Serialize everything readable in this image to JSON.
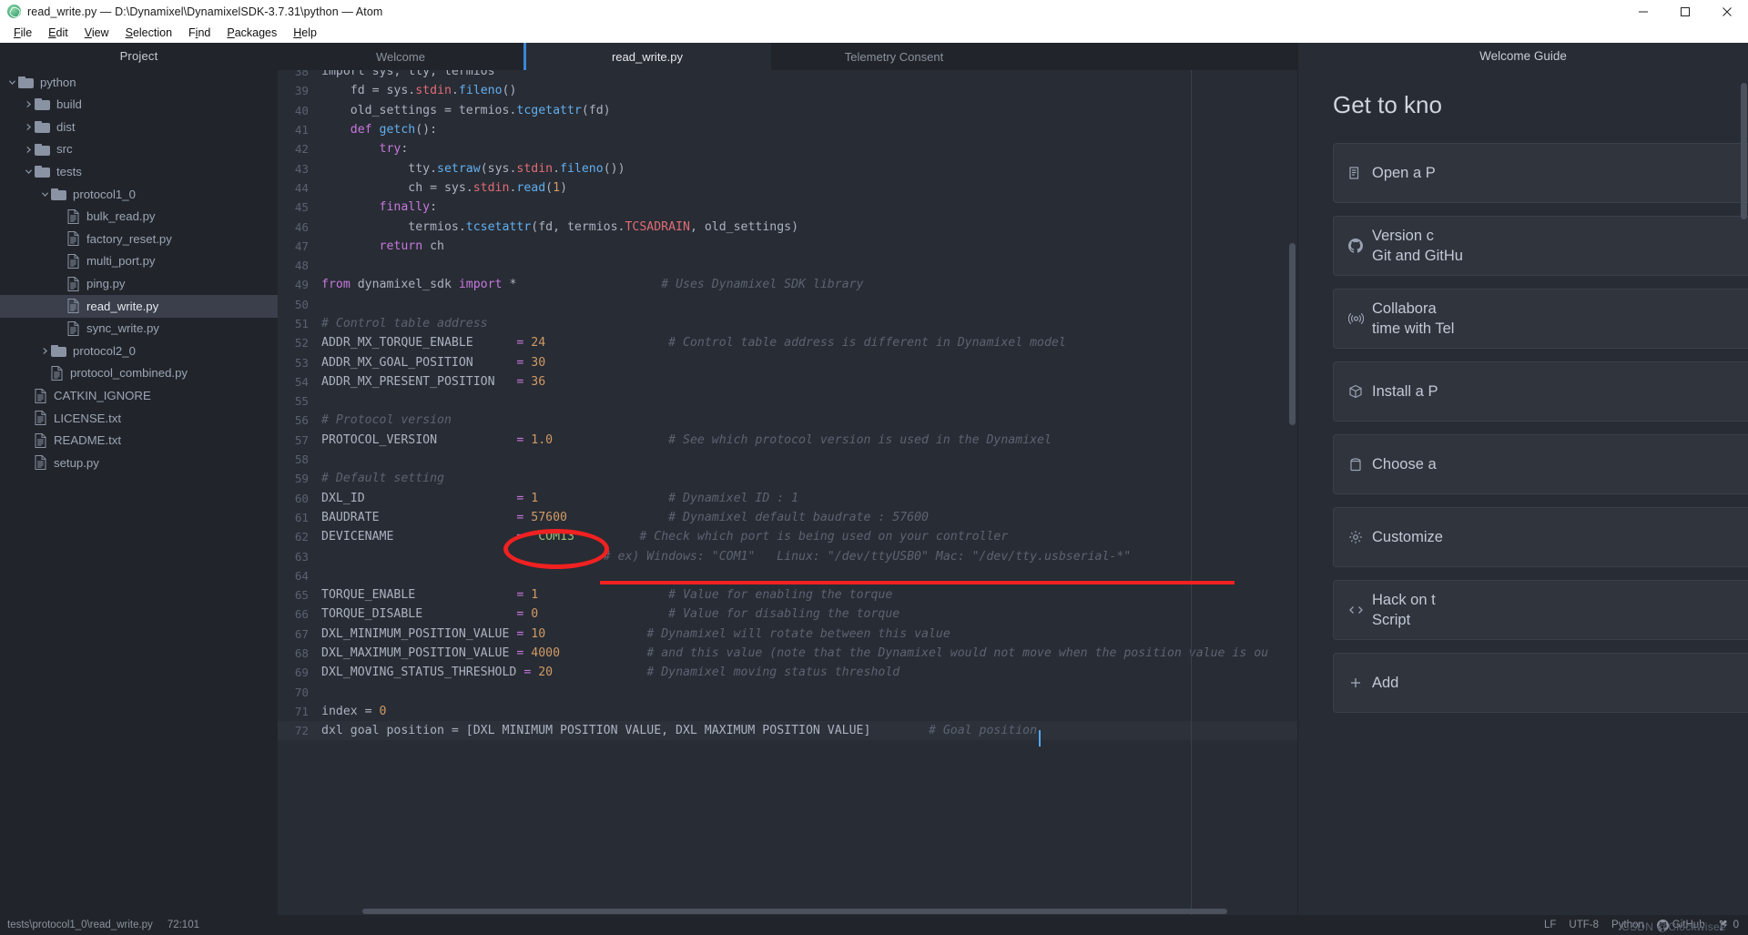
{
  "window": {
    "title": "read_write.py — D:\\Dynamixel\\DynamixelSDK-3.7.31\\python — Atom",
    "app_icon": "atom-icon",
    "controls": {
      "minimize": "minimize-icon",
      "maximize": "maximize-icon",
      "close": "close-icon"
    }
  },
  "menu": {
    "items": [
      "File",
      "Edit",
      "View",
      "Selection",
      "Find",
      "Packages",
      "Help"
    ]
  },
  "sidebar": {
    "title": "Project",
    "tree": [
      {
        "label": "python",
        "type": "folder",
        "depth": 0,
        "twisty": "chevron-down",
        "selected": false
      },
      {
        "label": "build",
        "type": "folder",
        "depth": 1,
        "twisty": "chevron-right",
        "selected": false
      },
      {
        "label": "dist",
        "type": "folder",
        "depth": 1,
        "twisty": "chevron-right",
        "selected": false
      },
      {
        "label": "src",
        "type": "folder",
        "depth": 1,
        "twisty": "chevron-right",
        "selected": false
      },
      {
        "label": "tests",
        "type": "folder",
        "depth": 1,
        "twisty": "chevron-down",
        "selected": false
      },
      {
        "label": "protocol1_0",
        "type": "folder",
        "depth": 2,
        "twisty": "chevron-down",
        "selected": false
      },
      {
        "label": "bulk_read.py",
        "type": "file",
        "depth": 3,
        "twisty": "",
        "selected": false
      },
      {
        "label": "factory_reset.py",
        "type": "file",
        "depth": 3,
        "twisty": "",
        "selected": false
      },
      {
        "label": "multi_port.py",
        "type": "file",
        "depth": 3,
        "twisty": "",
        "selected": false
      },
      {
        "label": "ping.py",
        "type": "file",
        "depth": 3,
        "twisty": "",
        "selected": false
      },
      {
        "label": "read_write.py",
        "type": "file",
        "depth": 3,
        "twisty": "",
        "selected": true
      },
      {
        "label": "sync_write.py",
        "type": "file",
        "depth": 3,
        "twisty": "",
        "selected": false
      },
      {
        "label": "protocol2_0",
        "type": "folder",
        "depth": 2,
        "twisty": "chevron-right",
        "selected": false
      },
      {
        "label": "protocol_combined.py",
        "type": "file",
        "depth": 2,
        "twisty": "",
        "selected": false
      },
      {
        "label": "CATKIN_IGNORE",
        "type": "file",
        "depth": 1,
        "twisty": "",
        "selected": false
      },
      {
        "label": "LICENSE.txt",
        "type": "file",
        "depth": 1,
        "twisty": "",
        "selected": false
      },
      {
        "label": "README.txt",
        "type": "file",
        "depth": 1,
        "twisty": "",
        "selected": false
      },
      {
        "label": "setup.py",
        "type": "file",
        "depth": 1,
        "twisty": "",
        "selected": false
      }
    ]
  },
  "tabs": [
    {
      "label": "Welcome",
      "active": false
    },
    {
      "label": "read_write.py",
      "active": true
    },
    {
      "label": "Telemetry Consent",
      "active": false
    }
  ],
  "editor": {
    "first_line": 38,
    "cursor_caret": "text-cursor",
    "lines": [
      {
        "n": 38,
        "tokens": [
          {
            "t": "import sys, tty, termios",
            "c": "pl"
          }
        ]
      },
      {
        "n": 39,
        "tokens": [
          {
            "t": "    fd = sys.",
            "c": "pl"
          },
          {
            "t": "stdin",
            "c": "bi"
          },
          {
            "t": ".",
            "c": "pl"
          },
          {
            "t": "fileno",
            "c": "fn"
          },
          {
            "t": "()",
            "c": "pl"
          }
        ]
      },
      {
        "n": 40,
        "tokens": [
          {
            "t": "    old_settings = termios.",
            "c": "pl"
          },
          {
            "t": "tcgetattr",
            "c": "fn"
          },
          {
            "t": "(fd)",
            "c": "pl"
          }
        ]
      },
      {
        "n": 41,
        "tokens": [
          {
            "t": "    ",
            "c": "pl"
          },
          {
            "t": "def ",
            "c": "k"
          },
          {
            "t": "getch",
            "c": "fn"
          },
          {
            "t": "():",
            "c": "pl"
          }
        ]
      },
      {
        "n": 42,
        "tokens": [
          {
            "t": "        ",
            "c": "pl"
          },
          {
            "t": "try",
            "c": "k"
          },
          {
            "t": ":",
            "c": "pl"
          }
        ]
      },
      {
        "n": 43,
        "tokens": [
          {
            "t": "            tty.",
            "c": "pl"
          },
          {
            "t": "setraw",
            "c": "fn"
          },
          {
            "t": "(sys.",
            "c": "pl"
          },
          {
            "t": "stdin",
            "c": "bi"
          },
          {
            "t": ".",
            "c": "pl"
          },
          {
            "t": "fileno",
            "c": "fn"
          },
          {
            "t": "())",
            "c": "pl"
          }
        ]
      },
      {
        "n": 44,
        "tokens": [
          {
            "t": "            ch = sys.",
            "c": "pl"
          },
          {
            "t": "stdin",
            "c": "bi"
          },
          {
            "t": ".",
            "c": "pl"
          },
          {
            "t": "read",
            "c": "fn"
          },
          {
            "t": "(",
            "c": "pl"
          },
          {
            "t": "1",
            "c": "num"
          },
          {
            "t": ")",
            "c": "pl"
          }
        ]
      },
      {
        "n": 45,
        "tokens": [
          {
            "t": "        ",
            "c": "pl"
          },
          {
            "t": "finally",
            "c": "k"
          },
          {
            "t": ":",
            "c": "pl"
          }
        ]
      },
      {
        "n": 46,
        "tokens": [
          {
            "t": "            termios.",
            "c": "pl"
          },
          {
            "t": "tcsetattr",
            "c": "fn"
          },
          {
            "t": "(fd, termios.",
            "c": "pl"
          },
          {
            "t": "TCSADRAIN",
            "c": "bi"
          },
          {
            "t": ", old_settings)",
            "c": "pl"
          }
        ]
      },
      {
        "n": 47,
        "tokens": [
          {
            "t": "        ",
            "c": "pl"
          },
          {
            "t": "return ",
            "c": "k"
          },
          {
            "t": "ch",
            "c": "pl"
          }
        ]
      },
      {
        "n": 48,
        "tokens": []
      },
      {
        "n": 49,
        "tokens": [
          {
            "t": "from ",
            "c": "k"
          },
          {
            "t": "dynamixel_sdk ",
            "c": "pl"
          },
          {
            "t": "import ",
            "c": "k"
          },
          {
            "t": "*",
            "c": "pl"
          },
          {
            "t": "                    ",
            "c": "pl"
          },
          {
            "t": "# Uses Dynamixel SDK library",
            "c": "cm"
          }
        ]
      },
      {
        "n": 50,
        "tokens": []
      },
      {
        "n": 51,
        "tokens": [
          {
            "t": "# Control table address",
            "c": "cm"
          }
        ]
      },
      {
        "n": 52,
        "tokens": [
          {
            "t": "ADDR_MX_TORQUE_ENABLE      ",
            "c": "pl"
          },
          {
            "t": "= ",
            "c": "op"
          },
          {
            "t": "24",
            "c": "num"
          },
          {
            "t": "                 ",
            "c": "pl"
          },
          {
            "t": "# Control table address is different in Dynamixel model",
            "c": "cm"
          }
        ]
      },
      {
        "n": 53,
        "tokens": [
          {
            "t": "ADDR_MX_GOAL_POSITION      ",
            "c": "pl"
          },
          {
            "t": "= ",
            "c": "op"
          },
          {
            "t": "30",
            "c": "num"
          }
        ]
      },
      {
        "n": 54,
        "tokens": [
          {
            "t": "ADDR_MX_PRESENT_POSITION   ",
            "c": "pl"
          },
          {
            "t": "= ",
            "c": "op"
          },
          {
            "t": "36",
            "c": "num"
          }
        ]
      },
      {
        "n": 55,
        "tokens": []
      },
      {
        "n": 56,
        "tokens": [
          {
            "t": "# Protocol version",
            "c": "cm"
          }
        ]
      },
      {
        "n": 57,
        "tokens": [
          {
            "t": "PROTOCOL_VERSION           ",
            "c": "pl"
          },
          {
            "t": "= ",
            "c": "op"
          },
          {
            "t": "1.0",
            "c": "num"
          },
          {
            "t": "                ",
            "c": "pl"
          },
          {
            "t": "# See which protocol version is used in the Dynamixel",
            "c": "cm"
          }
        ]
      },
      {
        "n": 58,
        "tokens": []
      },
      {
        "n": 59,
        "tokens": [
          {
            "t": "# Default setting",
            "c": "cm"
          }
        ]
      },
      {
        "n": 60,
        "tokens": [
          {
            "t": "DXL_ID                     ",
            "c": "pl"
          },
          {
            "t": "= ",
            "c": "op"
          },
          {
            "t": "1",
            "c": "num"
          },
          {
            "t": "                  ",
            "c": "pl"
          },
          {
            "t": "# Dynamixel ID : 1",
            "c": "cm"
          }
        ]
      },
      {
        "n": 61,
        "tokens": [
          {
            "t": "BAUDRATE                   ",
            "c": "pl"
          },
          {
            "t": "= ",
            "c": "op"
          },
          {
            "t": "57600",
            "c": "num"
          },
          {
            "t": "              ",
            "c": "pl"
          },
          {
            "t": "# Dynamixel default baudrate : 57600",
            "c": "cm"
          }
        ]
      },
      {
        "n": 62,
        "tokens": [
          {
            "t": "DEVICENAME                 ",
            "c": "pl"
          },
          {
            "t": "= ",
            "c": "op"
          },
          {
            "t": "'COM13'",
            "c": "str"
          },
          {
            "t": "        ",
            "c": "pl"
          },
          {
            "t": "# Check which port is being used on your controller",
            "c": "cm"
          }
        ]
      },
      {
        "n": 63,
        "tokens": [
          {
            "t": "                                       ",
            "c": "pl"
          },
          {
            "t": "# ex) Windows: \"COM1\"   Linux: \"/dev/ttyUSB0\" Mac: \"/dev/tty.usbserial-*\"",
            "c": "cm"
          }
        ]
      },
      {
        "n": 64,
        "tokens": []
      },
      {
        "n": 65,
        "tokens": [
          {
            "t": "TORQUE_ENABLE              ",
            "c": "pl"
          },
          {
            "t": "= ",
            "c": "op"
          },
          {
            "t": "1",
            "c": "num"
          },
          {
            "t": "                  ",
            "c": "pl"
          },
          {
            "t": "# Value for enabling the torque",
            "c": "cm"
          }
        ]
      },
      {
        "n": 66,
        "tokens": [
          {
            "t": "TORQUE_DISABLE             ",
            "c": "pl"
          },
          {
            "t": "= ",
            "c": "op"
          },
          {
            "t": "0",
            "c": "num"
          },
          {
            "t": "                  ",
            "c": "pl"
          },
          {
            "t": "# Value for disabling the torque",
            "c": "cm"
          }
        ]
      },
      {
        "n": 67,
        "tokens": [
          {
            "t": "DXL_MINIMUM_POSITION_VALUE ",
            "c": "pl"
          },
          {
            "t": "= ",
            "c": "op"
          },
          {
            "t": "10",
            "c": "num"
          },
          {
            "t": "              ",
            "c": "pl"
          },
          {
            "t": "# Dynamixel will rotate between this value",
            "c": "cm"
          }
        ]
      },
      {
        "n": 68,
        "tokens": [
          {
            "t": "DXL_MAXIMUM_POSITION_VALUE ",
            "c": "pl"
          },
          {
            "t": "= ",
            "c": "op"
          },
          {
            "t": "4000",
            "c": "num"
          },
          {
            "t": "            ",
            "c": "pl"
          },
          {
            "t": "# and this value (note that the Dynamixel would not move when the position value is ou",
            "c": "cm"
          }
        ]
      },
      {
        "n": 69,
        "tokens": [
          {
            "t": "DXL_MOVING_STATUS_THRESHOLD ",
            "c": "pl"
          },
          {
            "t": "= ",
            "c": "op"
          },
          {
            "t": "20",
            "c": "num"
          },
          {
            "t": "             ",
            "c": "pl"
          },
          {
            "t": "# Dynamixel moving status threshold",
            "c": "cm"
          }
        ]
      },
      {
        "n": 70,
        "tokens": []
      },
      {
        "n": 71,
        "tokens": [
          {
            "t": "index = ",
            "c": "pl"
          },
          {
            "t": "0",
            "c": "num"
          }
        ]
      },
      {
        "n": 72,
        "tokens": [
          {
            "t": "dxl goal position = [DXL MINIMUM POSITION VALUE, DXL MAXIMUM POSITION VALUE]",
            "c": "pl"
          },
          {
            "t": "        ",
            "c": "pl"
          },
          {
            "t": "# Goal position",
            "c": "cm"
          }
        ],
        "cursor_line": true
      }
    ],
    "annotations": {
      "ellipse": {
        "shape": "red-ellipse",
        "target": "= 'COM13'"
      },
      "underline": {
        "shape": "red-underline",
        "target": "line-63-comment"
      }
    }
  },
  "welcome_guide": {
    "title": "Welcome Guide",
    "heading": "Get to kno",
    "cards": [
      {
        "icon": "project-icon",
        "line1": "Open a P",
        "line2": ""
      },
      {
        "icon": "github-icon",
        "line1": "Version c",
        "line2": "Git and GitHu"
      },
      {
        "icon": "broadcast-icon",
        "line1": "Collabora",
        "line2": "time with Tel"
      },
      {
        "icon": "package-icon",
        "line1": "Install a P",
        "line2": ""
      },
      {
        "icon": "paintcan-icon",
        "line1": "Choose a",
        "line2": ""
      },
      {
        "icon": "gear-icon",
        "line1": "Customize",
        "line2": ""
      },
      {
        "icon": "code-icon",
        "line1": "Hack on t",
        "line2": "Script"
      },
      {
        "icon": "plus-icon",
        "line1": "Add",
        "line2": ""
      }
    ]
  },
  "statusbar": {
    "file_path": "tests\\protocol1_0\\read_write.py",
    "cursor_position": "72:101",
    "line_ending": "LF",
    "encoding": "UTF-8",
    "grammar": "Python",
    "github_label": "GitHub",
    "git_label": "0",
    "git_icon": "git-branch-icon",
    "github_icon": "github-icon"
  },
  "watermark": "CSDN @Clockwisee"
}
